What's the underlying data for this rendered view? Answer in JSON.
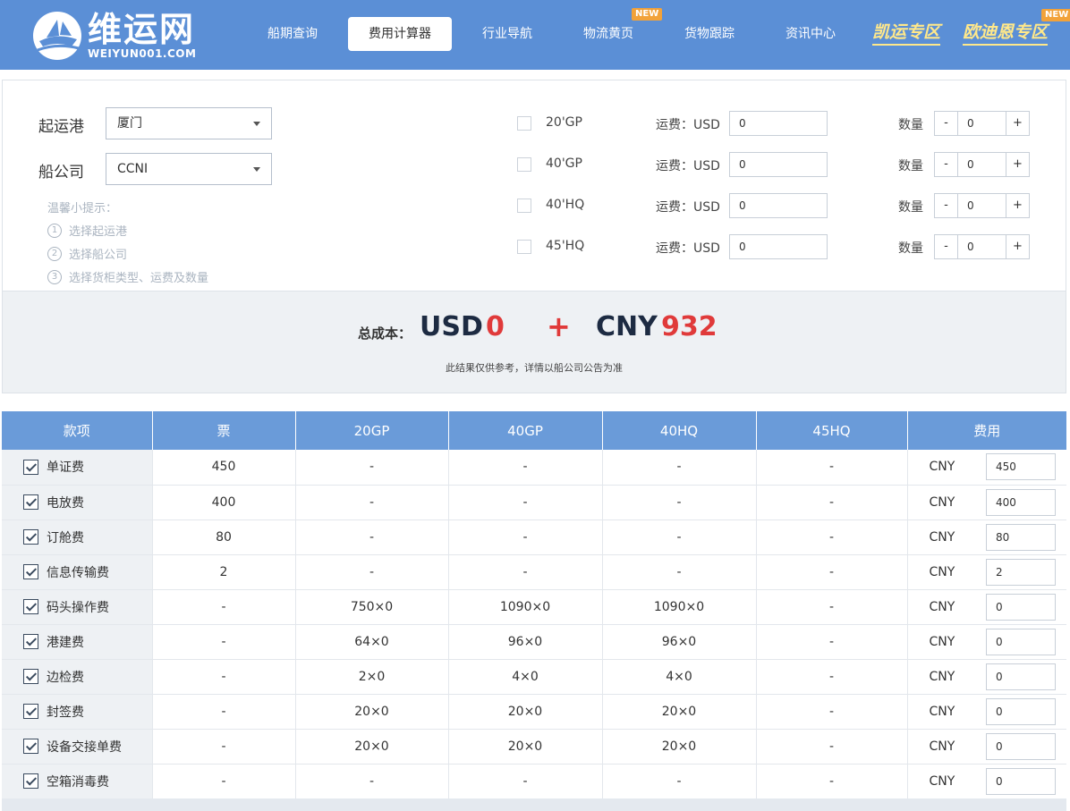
{
  "logo": {
    "cn": "维运网",
    "en": "WEIYUN001.COM"
  },
  "nav": [
    {
      "label": "船期查询",
      "active": false,
      "new": false
    },
    {
      "label": "费用计算器",
      "active": true,
      "new": false
    },
    {
      "label": "行业导航",
      "active": false,
      "new": false
    },
    {
      "label": "物流黄页",
      "active": false,
      "new": true
    },
    {
      "label": "货物跟踪",
      "active": false,
      "new": false
    },
    {
      "label": "资讯中心",
      "active": false,
      "new": false
    }
  ],
  "nav_special": [
    {
      "label": "凯运专区",
      "new": false
    },
    {
      "label": "欧迪恩专区",
      "new": true
    }
  ],
  "new_badge": "NEW",
  "form": {
    "port_label": "起运港",
    "port_value": "厦门",
    "carrier_label": "船公司",
    "carrier_value": "CCNI",
    "tips_title": "温馨小提示：",
    "tips": [
      {
        "num": "1",
        "text": "选择起运港"
      },
      {
        "num": "2",
        "text": "选择船公司"
      },
      {
        "num": "3",
        "text": "选择货柜类型、运费及数量"
      }
    ]
  },
  "containers": [
    {
      "name": "20'GP",
      "freight_label": "运费：USD",
      "freight": "0",
      "qty_label": "数量",
      "qty": "0"
    },
    {
      "name": "40'GP",
      "freight_label": "运费：USD",
      "freight": "0",
      "qty_label": "数量",
      "qty": "0"
    },
    {
      "name": "40'HQ",
      "freight_label": "运费：USD",
      "freight": "0",
      "qty_label": "数量",
      "qty": "0"
    },
    {
      "name": "45'HQ",
      "freight_label": "运费：USD",
      "freight": "0",
      "qty_label": "数量",
      "qty": "0"
    }
  ],
  "stepper": {
    "minus": "-",
    "plus": "+"
  },
  "total": {
    "label": "总成本：",
    "usd_cur": "USD",
    "usd_amt": "0",
    "plus": "+",
    "cny_cur": "CNY",
    "cny_amt": "932",
    "note": "此结果仅供参考，详情以船公司公告为准"
  },
  "table": {
    "headers": [
      "款项",
      "票",
      "20GP",
      "40GP",
      "40HQ",
      "45HQ",
      "费用"
    ],
    "rows": [
      {
        "item": "单证费",
        "ticket": "450",
        "gp20": "-",
        "gp40": "-",
        "hq40": "-",
        "hq45": "-",
        "cur": "CNY",
        "fee": "450"
      },
      {
        "item": "电放费",
        "ticket": "400",
        "gp20": "-",
        "gp40": "-",
        "hq40": "-",
        "hq45": "-",
        "cur": "CNY",
        "fee": "400"
      },
      {
        "item": "订舱费",
        "ticket": "80",
        "gp20": "-",
        "gp40": "-",
        "hq40": "-",
        "hq45": "-",
        "cur": "CNY",
        "fee": "80"
      },
      {
        "item": "信息传输费",
        "ticket": "2",
        "gp20": "-",
        "gp40": "-",
        "hq40": "-",
        "hq45": "-",
        "cur": "CNY",
        "fee": "2"
      },
      {
        "item": "码头操作费",
        "ticket": "-",
        "gp20": "750×0",
        "gp40": "1090×0",
        "hq40": "1090×0",
        "hq45": "-",
        "cur": "CNY",
        "fee": "0"
      },
      {
        "item": "港建费",
        "ticket": "-",
        "gp20": "64×0",
        "gp40": "96×0",
        "hq40": "96×0",
        "hq45": "-",
        "cur": "CNY",
        "fee": "0"
      },
      {
        "item": "边检费",
        "ticket": "-",
        "gp20": "2×0",
        "gp40": "4×0",
        "hq40": "4×0",
        "hq45": "-",
        "cur": "CNY",
        "fee": "0"
      },
      {
        "item": "封签费",
        "ticket": "-",
        "gp20": "20×0",
        "gp40": "20×0",
        "hq40": "20×0",
        "hq45": "-",
        "cur": "CNY",
        "fee": "0"
      },
      {
        "item": "设备交接单费",
        "ticket": "-",
        "gp20": "20×0",
        "gp40": "20×0",
        "hq40": "20×0",
        "hq45": "-",
        "cur": "CNY",
        "fee": "0"
      },
      {
        "item": "空箱消毒费",
        "ticket": "-",
        "gp20": "-",
        "gp40": "-",
        "hq40": "-",
        "hq45": "-",
        "cur": "CNY",
        "fee": "0"
      }
    ]
  }
}
